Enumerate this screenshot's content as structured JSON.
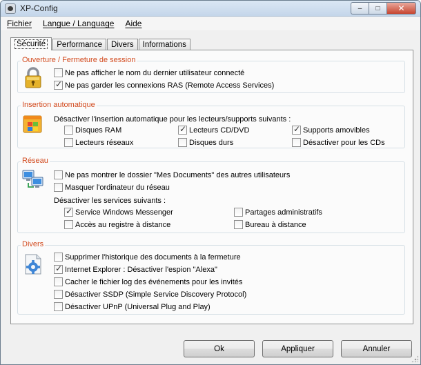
{
  "window": {
    "title": "XP-Config"
  },
  "window_controls": {
    "minimize": "–",
    "maximize": "□",
    "close": "✕"
  },
  "menu": [
    "Fichier",
    "Langue / Language",
    "Aide"
  ],
  "tabs": [
    "Sécurité",
    "Performance",
    "Divers",
    "Informations"
  ],
  "active_tab": "Sécurité",
  "groups": {
    "session": {
      "title": "Ouverture / Fermeture de session",
      "icon": "padlock-icon",
      "options": [
        {
          "label": "Ne pas afficher le nom du dernier utilisateur connecté",
          "checked": false
        },
        {
          "label": "Ne pas garder les connexions RAS (Remote Access Services)",
          "checked": true
        }
      ]
    },
    "autorun": {
      "title": "Insertion automatique",
      "icon": "autorun-windows-icon",
      "description": "Désactiver l'insertion automatique pour les lecteurs/supports suivants :",
      "options": [
        {
          "label": "Disques RAM",
          "checked": false
        },
        {
          "label": "Lecteurs CD/DVD",
          "checked": true
        },
        {
          "label": "Supports amovibles",
          "checked": true
        },
        {
          "label": "Lecteurs réseaux",
          "checked": false
        },
        {
          "label": "Disques durs",
          "checked": false
        },
        {
          "label": "Désactiver pour les CDs",
          "checked": false
        }
      ]
    },
    "network": {
      "title": "Réseau",
      "icon": "network-computers-icon",
      "options": [
        {
          "label": "Ne pas montrer le dossier \"Mes Documents\" des autres utilisateurs",
          "checked": false
        },
        {
          "label": "Masquer l'ordinateur du réseau",
          "checked": false
        }
      ],
      "services_label": "Désactiver les services suivants :",
      "services": [
        {
          "label": "Service Windows Messenger",
          "checked": true
        },
        {
          "label": "Partages administratifs",
          "checked": false
        },
        {
          "label": "Accès au registre à distance",
          "checked": false
        },
        {
          "label": "Bureau à distance",
          "checked": false
        }
      ]
    },
    "misc": {
      "title": "Divers",
      "icon": "settings-gear-icon",
      "options": [
        {
          "label": "Supprimer l'historique des documents à la fermeture",
          "checked": false
        },
        {
          "label": "Internet Explorer : Désactiver l'espion \"Alexa\"",
          "checked": true
        },
        {
          "label": "Cacher le fichier log des événements pour les invités",
          "checked": false
        },
        {
          "label": "Désactiver SSDP (Simple Service Discovery Protocol)",
          "checked": false
        },
        {
          "label": "Désactiver UPnP (Universal Plug and Play)",
          "checked": false
        }
      ]
    }
  },
  "buttons": {
    "ok": "Ok",
    "apply": "Appliquer",
    "cancel": "Annuler"
  },
  "colors": {
    "group_title": "#d24a1e",
    "titlebar": "#c4d6ea",
    "close_button": "#c7452f"
  }
}
